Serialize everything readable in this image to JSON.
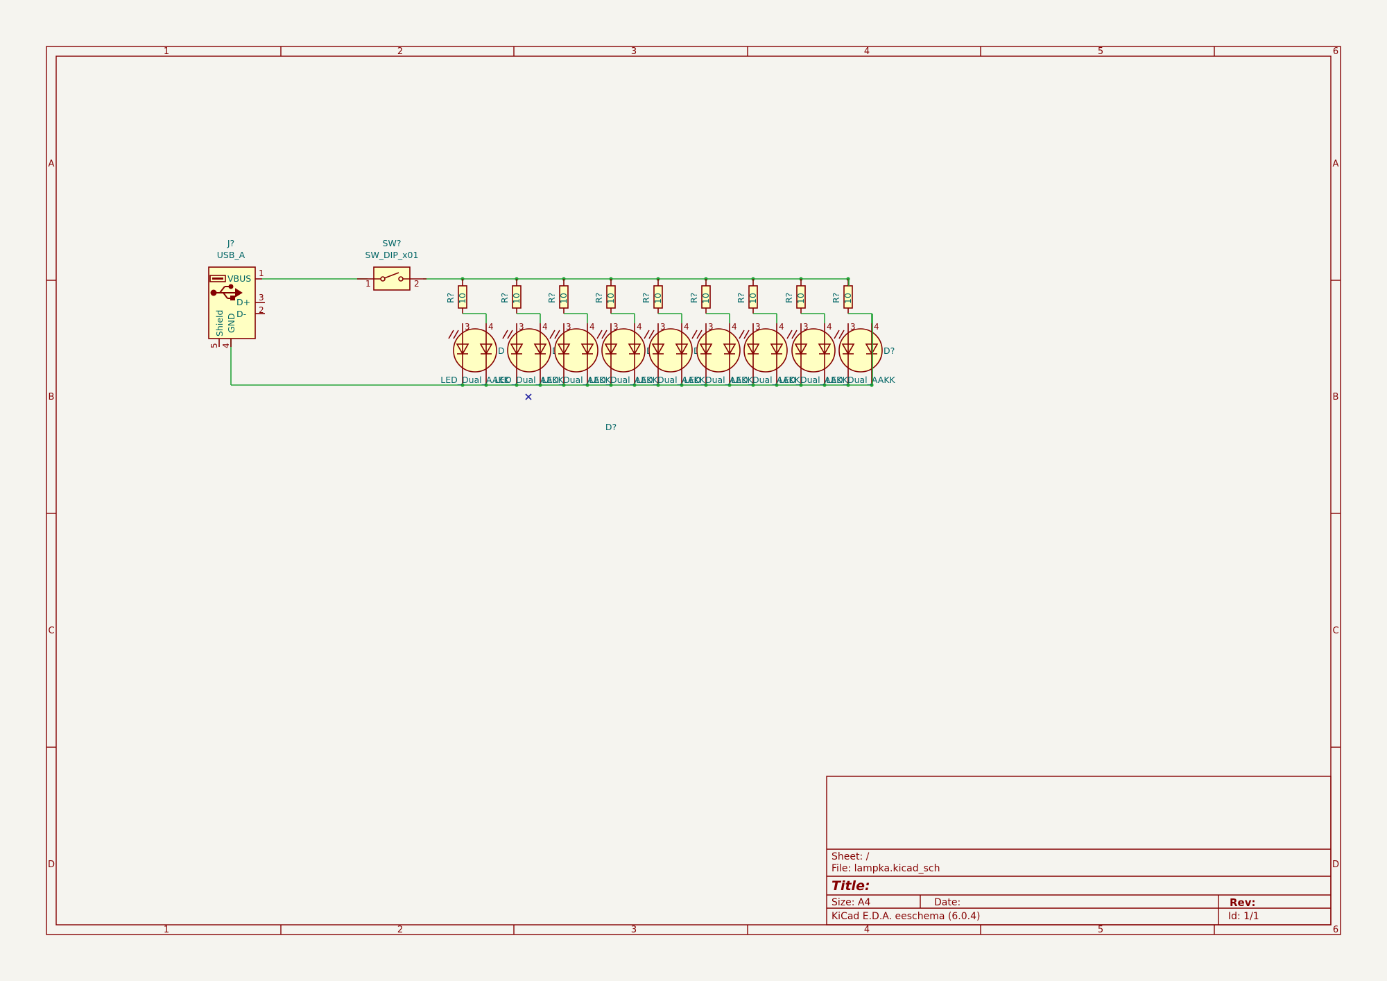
{
  "app": {
    "name": "KiCad E.D.A.  eeschema (6.0.4)"
  },
  "frame": {
    "columns": [
      "1",
      "2",
      "3",
      "4",
      "5",
      "6"
    ],
    "rows": [
      "A",
      "B",
      "C",
      "D"
    ]
  },
  "title_block": {
    "sheet": "Sheet: /",
    "file": "File: lampka.kicad_sch",
    "title": "Title:",
    "size": "Size: A4",
    "date": "Date:",
    "rev": "Rev:",
    "tool": "KiCad E.D.A.  eeschema (6.0.4)",
    "id": "Id: 1/1"
  },
  "components": {
    "usb": {
      "ref": "J?",
      "value": "USB_A",
      "pin_vbus": "VBUS",
      "pin_dp": "D+",
      "pin_dm": "D-",
      "pin_shield": "Shield",
      "pin_gnd": "GND",
      "pin1": "1",
      "pin2": "2",
      "pin3": "3",
      "pin4": "4",
      "pin5": "5"
    },
    "switch": {
      "ref": "SW?",
      "value": "SW_DIP_x01",
      "pin1": "1",
      "pin2": "2"
    },
    "resistor": {
      "ref": "R?",
      "value": "10"
    },
    "led": {
      "ref": "D?",
      "value": "LED_Dual_AAKK",
      "pin3": "3",
      "pin4": "4"
    },
    "stray_ref": "D?",
    "led_ref_texts": [
      "D",
      "D",
      "",
      "D",
      "D",
      "",
      "",
      "",
      "D?"
    ],
    "led_value_texts": [
      "LED_Dual_AAKK",
      "LED_Dual_AAKK",
      "LED_Dual_AAKK",
      "LED_Dual_AAKK",
      "LED_Dual_AAKK",
      "LED_Dual_AAKK",
      "LED_Dual_AAKK",
      "LED_Dual_AAKK",
      "LED_Dual_AAKK"
    ]
  }
}
